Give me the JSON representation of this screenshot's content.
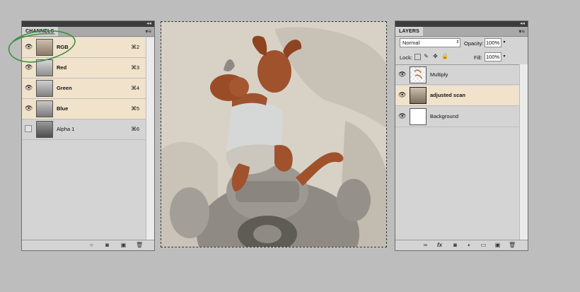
{
  "channels": {
    "tab_label": "CHANNELS",
    "collapse_glyph": "◂◂",
    "menu_glyph": "▾≡",
    "items": [
      {
        "label": "RGB",
        "shortcut": "⌘2",
        "visible": true,
        "selected": true
      },
      {
        "label": "Red",
        "shortcut": "⌘3",
        "visible": true,
        "selected": true
      },
      {
        "label": "Green",
        "shortcut": "⌘4",
        "visible": true,
        "selected": true
      },
      {
        "label": "Blue",
        "shortcut": "⌘5",
        "visible": true,
        "selected": true
      },
      {
        "label": "Alpha 1",
        "shortcut": "⌘6",
        "visible": false,
        "selected": false
      }
    ]
  },
  "layers": {
    "tab_label": "LAYERS",
    "collapse_glyph": "◂◂",
    "menu_glyph": "▾≡",
    "blend_mode": "Normal",
    "opacity_label": "Opacity:",
    "opacity_value": "100%",
    "lock_label": "Lock:",
    "fill_label": "Fill:",
    "fill_value": "100%",
    "items": [
      {
        "label": "Multiply",
        "selected": false
      },
      {
        "label": "adjusted scan",
        "selected": true
      },
      {
        "label": "Background",
        "selected": false
      }
    ]
  },
  "colors": {
    "selection": "#f1e2cb",
    "annotation": "#3f8f3f",
    "character": "#a0522d"
  }
}
